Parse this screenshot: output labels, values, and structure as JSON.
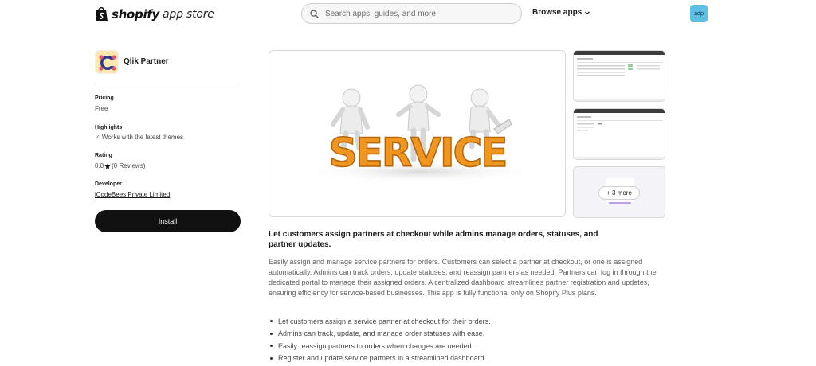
{
  "header": {
    "logo_word": "shopify",
    "logo_sub": "app store",
    "search_placeholder": "Search apps, guides, and more",
    "browse_label": "Browse apps",
    "avatar_text": "adp",
    "avatar_color": "#5fc0e6"
  },
  "app": {
    "name": "Qlik Partner",
    "pricing_label": "Pricing",
    "pricing_value": "Free",
    "highlights_label": "Highlights",
    "highlights_value": "✓ Works with the latest themes",
    "rating_label": "Rating",
    "rating_score": "0.0",
    "rating_reviews": "(0 Reviews)",
    "developer_label": "Developer",
    "developer_name": "iCodeBees Private Limited",
    "install_label": "Install"
  },
  "media": {
    "hero_word": "SERVICE",
    "more_label": "+ 3 more"
  },
  "description": {
    "heading": "Let customers assign partners at checkout while admins manage orders, statuses, and partner updates.",
    "body": "Easily assign and manage service partners for orders. Customers can select a partner at checkout, or one is assigned automatically. Admins can track orders, update statuses, and reassign partners as needed. Partners can log in through the dedicated portal to manage their assigned orders. A centralized dashboard streamlines partner registration and updates, ensuring efficiency for service-based businesses. This app is fully functional only on Shopify Plus plans.",
    "features": [
      "Let customers assign a service partner at checkout for their orders.",
      "Admins can track, update, and manage order statuses with ease.",
      "Easily reassign partners to orders when changes are needed.",
      "Register and update service partners in a streamlined dashboard."
    ]
  },
  "colors": {
    "install_bg": "#111111",
    "hero_orange": "#f0961e"
  }
}
